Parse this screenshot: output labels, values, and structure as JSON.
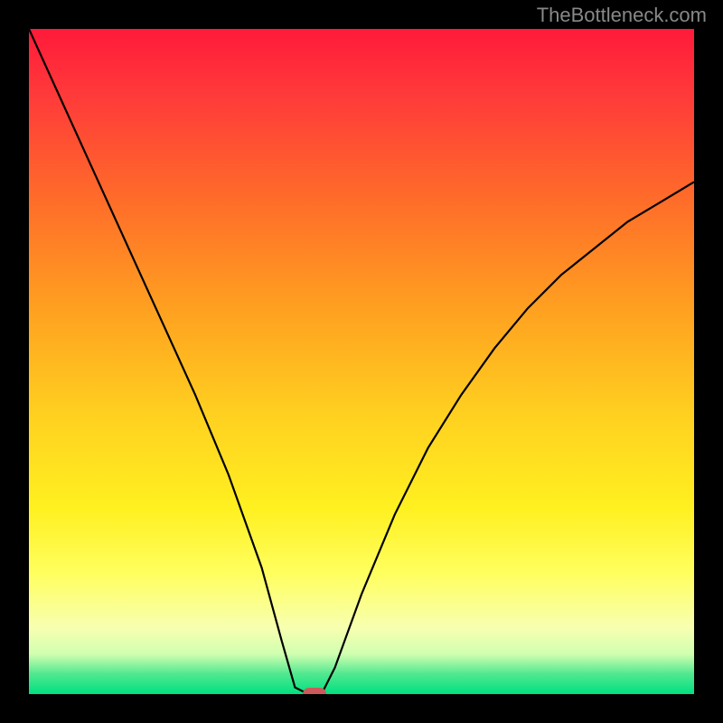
{
  "watermark": "TheBottleneck.com",
  "chart_data": {
    "type": "line",
    "title": "",
    "xlabel": "",
    "ylabel": "",
    "xlim": [
      0,
      100
    ],
    "ylim": [
      0,
      100
    ],
    "grid": false,
    "series": [
      {
        "name": "bottleneck-curve",
        "x": [
          0,
          5,
          10,
          15,
          20,
          25,
          30,
          35,
          38,
          40,
          42,
          43,
          44,
          46,
          50,
          55,
          60,
          65,
          70,
          75,
          80,
          85,
          90,
          95,
          100
        ],
        "values": [
          100,
          89,
          78,
          67,
          56,
          45,
          33,
          19,
          8,
          1,
          0,
          0,
          0,
          4,
          15,
          27,
          37,
          45,
          52,
          58,
          63,
          67,
          71,
          74,
          77
        ]
      }
    ],
    "marker": {
      "x": 43,
      "y": 0,
      "color": "#cc5a5a"
    },
    "gradient_stops": [
      {
        "pos": 0,
        "color": "#ff1a3a"
      },
      {
        "pos": 25,
        "color": "#ff6a2a"
      },
      {
        "pos": 58,
        "color": "#ffd020"
      },
      {
        "pos": 82,
        "color": "#ffff60"
      },
      {
        "pos": 100,
        "color": "#00e080"
      }
    ]
  }
}
